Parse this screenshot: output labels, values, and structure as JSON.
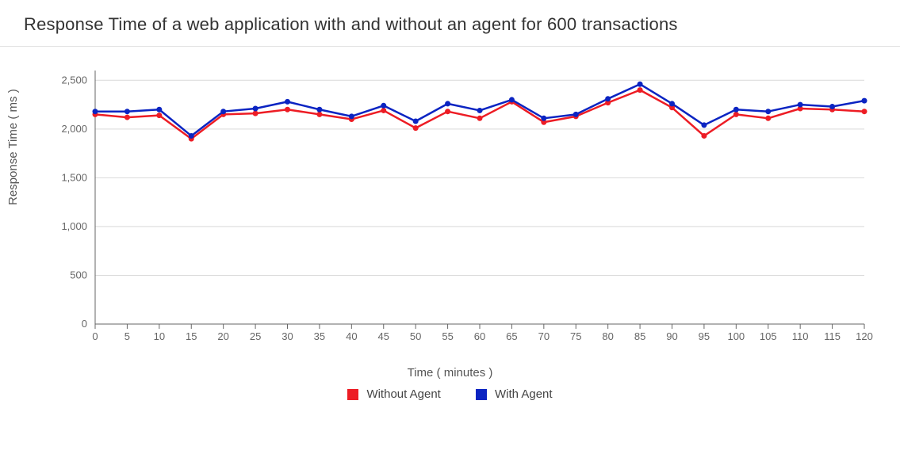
{
  "chart_data": {
    "type": "line",
    "title": "Response Time of a web application with and without an agent for 600 transactions",
    "xlabel": "Time ( minutes )",
    "ylabel": "Response Time ( ms )",
    "ylim": [
      0,
      2600
    ],
    "yticks": [
      0,
      500,
      1000,
      1500,
      2000,
      2500
    ],
    "ytick_labels": [
      "0",
      "500",
      "1,000",
      "1,500",
      "2,000",
      "2,500"
    ],
    "x": [
      0,
      5,
      10,
      15,
      20,
      25,
      30,
      35,
      40,
      45,
      50,
      55,
      60,
      65,
      70,
      75,
      80,
      85,
      90,
      95,
      100,
      105,
      110,
      115,
      120
    ],
    "series": [
      {
        "name": "Without Agent",
        "color": "#ed1c24",
        "values": [
          2150,
          2120,
          2140,
          1900,
          2150,
          2160,
          2200,
          2150,
          2100,
          2190,
          2010,
          2180,
          2110,
          2280,
          2070,
          2130,
          2270,
          2400,
          2220,
          1930,
          2150,
          2110,
          2210,
          2200,
          2180
        ]
      },
      {
        "name": "With Agent",
        "color": "#0b24c2",
        "values": [
          2180,
          2180,
          2200,
          1930,
          2180,
          2210,
          2280,
          2200,
          2130,
          2240,
          2080,
          2260,
          2190,
          2300,
          2110,
          2150,
          2310,
          2460,
          2260,
          2040,
          2200,
          2180,
          2250,
          2230,
          2290
        ]
      }
    ]
  },
  "legend": {
    "items": [
      {
        "label": "Without Agent",
        "color": "#ed1c24"
      },
      {
        "label": "With Agent",
        "color": "#0b24c2"
      }
    ]
  }
}
